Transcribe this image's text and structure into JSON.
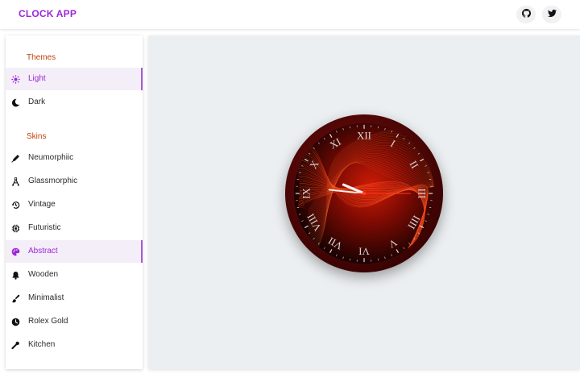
{
  "app": {
    "title": "CLOCK APP"
  },
  "header": {
    "buttons": [
      {
        "icon": "github-icon"
      },
      {
        "icon": "twitter-icon"
      }
    ]
  },
  "sidebar": {
    "themes": {
      "title": "Themes",
      "items": [
        {
          "label": "Light",
          "icon": "sun-icon",
          "selected": true
        },
        {
          "label": "Dark",
          "icon": "moon-icon",
          "selected": false
        }
      ]
    },
    "skins": {
      "title": "Skins",
      "items": [
        {
          "label": "Neumorphiic",
          "icon": "pen-icon",
          "selected": false
        },
        {
          "label": "Glassmorphic",
          "icon": "vector-icon",
          "selected": false
        },
        {
          "label": "Vintage",
          "icon": "history-icon",
          "selected": false
        },
        {
          "label": "Futuristic",
          "icon": "chip-icon",
          "selected": false
        },
        {
          "label": "Abstract",
          "icon": "palette-icon",
          "selected": true
        },
        {
          "label": "Wooden",
          "icon": "bell-icon",
          "selected": false
        },
        {
          "label": "Minimalist",
          "icon": "brush-icon",
          "selected": false
        },
        {
          "label": "Rolex Gold",
          "icon": "clock-icon",
          "selected": false
        },
        {
          "label": "Kitchen",
          "icon": "spatula-icon",
          "selected": false
        }
      ]
    }
  },
  "clock": {
    "numerals": [
      "XII",
      "I",
      "II",
      "III",
      "IIII",
      "V",
      "VI",
      "VII",
      "VIII",
      "IX",
      "X",
      "XI"
    ],
    "time": {
      "hour": 9,
      "minute": 46,
      "second": 15
    },
    "colors": {
      "rim": "#4a0606",
      "face": "#0b0101",
      "accent": "#ff3b1f",
      "numeral": "#d9d9d9"
    }
  },
  "colors": {
    "brand": "#9c27d9",
    "section": "#c2410c",
    "selected_bg": "#f4eef8"
  }
}
